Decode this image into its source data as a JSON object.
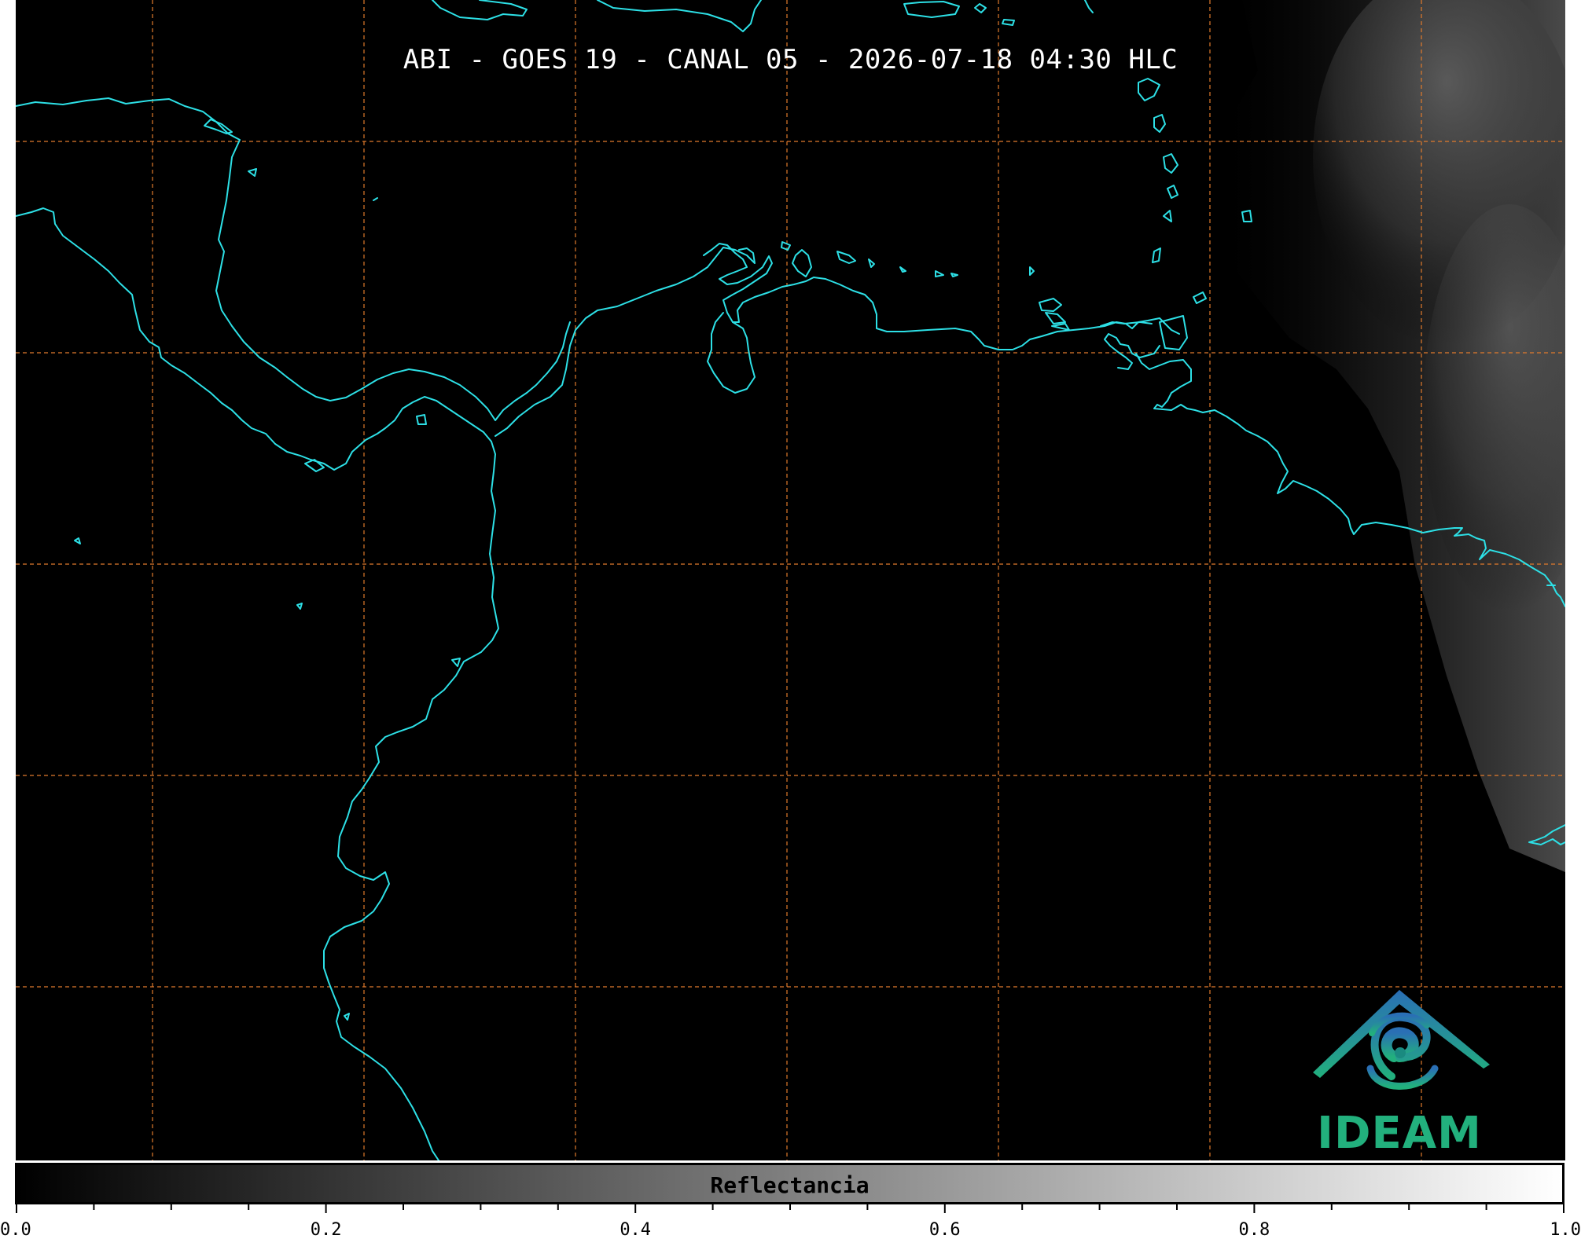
{
  "title": "ABI - GOES 19 - CANAL 05 - 2026-07-18 04:30 HLC",
  "colorbar": {
    "label": "Reflectancia",
    "range": [
      0.0,
      1.0
    ],
    "ticks": [
      "0.0",
      "0.2",
      "0.4",
      "0.6",
      "0.8",
      "1.0"
    ],
    "colormap": "grayscale black-to-white"
  },
  "logo": {
    "text": "IDEAM"
  },
  "colors": {
    "background": "#000000",
    "coastline": "#2de0e6",
    "gridlines": "#e07a2c",
    "logo_green": "#22b07d",
    "logo_blue": "#2a6fb5"
  },
  "gridlines": {
    "style": "dashed",
    "vertical_count": 7,
    "horizontal_count": 5
  }
}
